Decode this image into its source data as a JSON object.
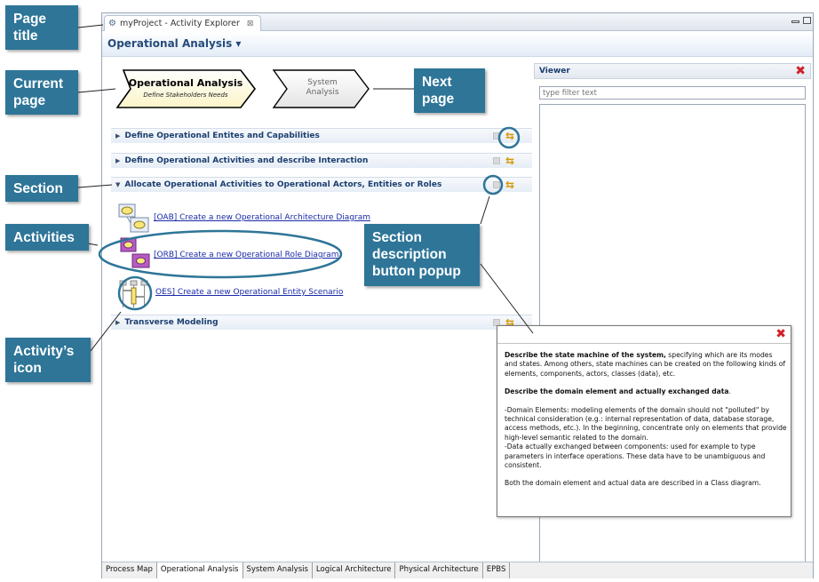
{
  "editor_tab": {
    "label": "myProject - Activity Explorer",
    "close_glyph": "⊠"
  },
  "page_header": {
    "title": "Operational Analysis ▾"
  },
  "nav": {
    "current": {
      "title": "Operational Analysis",
      "subtitle": "Define Stakeholders Needs"
    },
    "next": {
      "line1": "System",
      "line2": "Analysis"
    }
  },
  "sections": [
    {
      "label": "Define Operational Entites and Capabilities",
      "expanded": false
    },
    {
      "label": "Define Operational Activities and describe Interaction",
      "expanded": false
    },
    {
      "label": "Allocate Operational Activities to Operational Actors, Entities or Roles",
      "expanded": true
    },
    {
      "label": "Transverse Modeling",
      "expanded": false
    }
  ],
  "activities": [
    {
      "label": "[OAB] Create a new Operational Architecture Diagram"
    },
    {
      "label": "[ORB] Create a new Operational Role Diagram"
    },
    {
      "label": "OES] Create a new Operational Entity Scenario"
    }
  ],
  "viewer": {
    "title": "Viewer",
    "filter_placeholder": "type filter text"
  },
  "bottom_tabs": [
    "Process Map",
    "Operational Analysis",
    "System Analysis",
    "Logical Architecture",
    "Physical Architecture",
    "EPBS"
  ],
  "popup": {
    "p1_bold": "Describe the state machine of the system,",
    "p1_rest": " specifying which are its modes and states. Among others, state machines can be created on the following kinds of elements, components, actors, classes (data), etc.",
    "p2_bold": "Describe the domain element and actually exchanged data",
    "p2_rest": ".",
    "p3": " -Domain Elements: modeling elements of the domain should not \"polluted\" by technical consideration (e.g.: internal representation of data, database storage, access methods, etc.). In the beginning, concentrate only on elements that provide high-level semantic related to the domain.",
    "p4": " -Data actually exchanged between components: used for example to type parameters in interface operations. These data have to be unambiguous and consistent.",
    "p5": " Both the domain element and actual data are described in a Class diagram."
  },
  "callouts": {
    "page_title": "Page title",
    "current_page": "Current page",
    "next_page": "Next page",
    "section": "Section",
    "activities": "Activities",
    "section_popup": "Section description button popup",
    "activity_icon": "Activity’s icon"
  },
  "colors": {
    "callout": "#2e7598",
    "highlight": "#2e7598",
    "close": "#d0202a"
  }
}
